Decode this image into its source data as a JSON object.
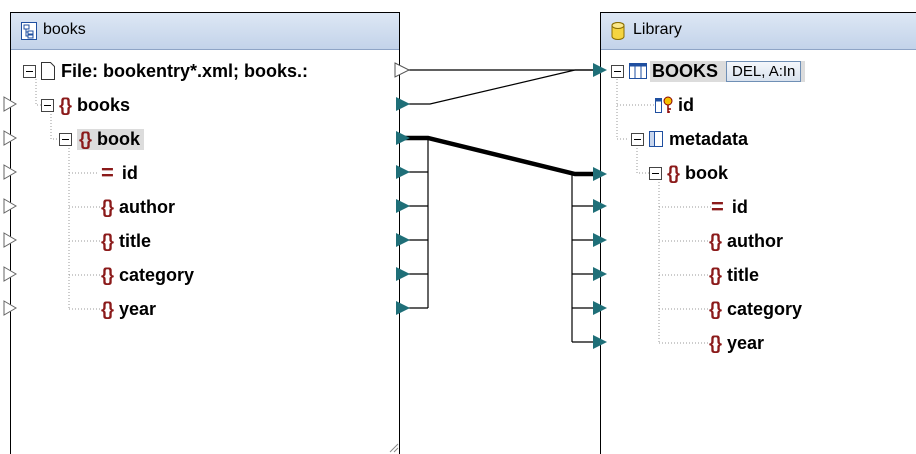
{
  "left_component": {
    "title": "books",
    "file_row": "File: bookentry*.xml; books.:",
    "items": [
      {
        "label": "books",
        "kind": "element"
      },
      {
        "label": "book",
        "kind": "element"
      },
      {
        "label": "id",
        "kind": "attribute"
      },
      {
        "label": "author",
        "kind": "element"
      },
      {
        "label": "title",
        "kind": "element"
      },
      {
        "label": "category",
        "kind": "element"
      },
      {
        "label": "year",
        "kind": "element"
      }
    ]
  },
  "right_component": {
    "title": "Library",
    "table": "BOOKS",
    "table_action": "DEL, A:In",
    "pk_field": "id",
    "metadata": "metadata",
    "items": [
      {
        "label": "book",
        "kind": "element"
      },
      {
        "label": "id",
        "kind": "attribute"
      },
      {
        "label": "author",
        "kind": "element"
      },
      {
        "label": "title",
        "kind": "element"
      },
      {
        "label": "category",
        "kind": "element"
      },
      {
        "label": "year",
        "kind": "element"
      }
    ]
  },
  "colors": {
    "connector": "#1f6f78",
    "element_icon": "#8b1a1a",
    "titlebar": "#c3d3ea"
  },
  "icons": [
    "xml-schema-icon",
    "database-icon",
    "file-icon",
    "table-icon",
    "primary-key-icon",
    "column-icon",
    "element-icon",
    "attribute-icon"
  ]
}
